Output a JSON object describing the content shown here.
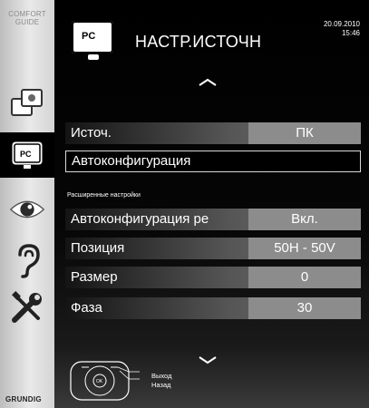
{
  "sidebar": {
    "comfort_guide": [
      "COMFORT",
      "GUIDE"
    ],
    "brand": "GRUNDIG",
    "items": [
      {
        "icon": "source-input-icon"
      },
      {
        "icon": "pc-monitor-icon",
        "selected": true
      },
      {
        "icon": "eye-icon"
      },
      {
        "icon": "ear-icon"
      },
      {
        "icon": "tools-icon"
      }
    ]
  },
  "header": {
    "badge": "PC",
    "title": "НАСТР.ИСТОЧН",
    "date": "20.09.2010",
    "time": "15:46"
  },
  "menu": {
    "rows": [
      {
        "label": "Источ.",
        "value": "ПК"
      },
      {
        "label": "Автоконфигурация"
      },
      {
        "label": "Автоконфигурация ре",
        "value": "Вкл."
      },
      {
        "label": "Позиция",
        "value": "50Н - 50V"
      },
      {
        "label": "Размер",
        "value": "0"
      },
      {
        "label": "Фаза",
        "value": "30"
      }
    ],
    "advanced_heading": "Расширенные настройки"
  },
  "footer": {
    "ok_label": "OK",
    "exit_label": "Выход",
    "back_label": "Назад"
  }
}
